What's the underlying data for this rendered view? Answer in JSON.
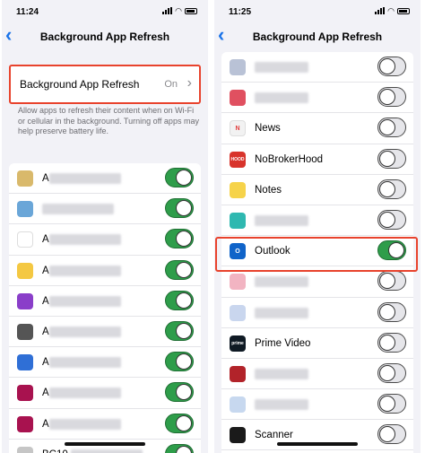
{
  "left": {
    "status_time": "11:24",
    "nav_title": "Background App Refresh",
    "master": {
      "label": "Background App Refresh",
      "value": "On"
    },
    "footnote": "Allow apps to refresh their content when on Wi-Fi or cellular in the background. Turning off apps may help preserve battery life.",
    "apps": [
      {
        "name": "A",
        "icon": "amazon-icon",
        "color": "#d9b96b",
        "on": true
      },
      {
        "name": "",
        "icon": "app-icon",
        "color": "#6aa6d8",
        "on": true
      },
      {
        "name": "A",
        "icon": "arrow-icon",
        "color": "#ffffff",
        "on": true
      },
      {
        "name": "A",
        "icon": "folder-icon",
        "color": "#f4c842",
        "on": true
      },
      {
        "name": "A",
        "icon": "spotify-icon",
        "color": "#8a3ec9",
        "on": true
      },
      {
        "name": "A",
        "icon": "circle-icon",
        "color": "#555555",
        "on": true
      },
      {
        "name": "A",
        "icon": "shield-icon",
        "color": "#2f6fd6",
        "on": true
      },
      {
        "name": "A",
        "icon": "axis-icon",
        "color": "#a8124f",
        "on": true
      },
      {
        "name": "A",
        "icon": "axis-icon",
        "color": "#a8124f",
        "on": true
      },
      {
        "name": "BC10",
        "icon": "app-icon",
        "color": "#c6c6c6",
        "on": true
      }
    ]
  },
  "right": {
    "status_time": "11:25",
    "nav_title": "Background App Refresh",
    "apps": [
      {
        "name": "",
        "icon": "app-icon",
        "color": "#b9c2d6",
        "on": false
      },
      {
        "name": "",
        "icon": "app-icon",
        "color": "#e05060",
        "on": false
      },
      {
        "name": "News",
        "icon": "news-icon",
        "color": "#f2f2f2",
        "on": false,
        "mark": "N"
      },
      {
        "name": "NoBrokerHood",
        "icon": "nobrokerhood-icon",
        "color": "#d8342c",
        "on": false,
        "mark": "HOOD"
      },
      {
        "name": "Notes",
        "icon": "notes-icon",
        "color": "#f6d34a",
        "on": false
      },
      {
        "name": "",
        "icon": "app-icon",
        "color": "#2fb8b0",
        "on": false
      },
      {
        "name": "Outlook",
        "icon": "outlook-icon",
        "color": "#1064c9",
        "on": true,
        "mark": "O"
      },
      {
        "name": "",
        "icon": "app-icon",
        "color": "#f2b4c2",
        "on": false
      },
      {
        "name": "",
        "icon": "app-icon",
        "color": "#c9d6ee",
        "on": false
      },
      {
        "name": "Prime Video",
        "icon": "prime-video-icon",
        "color": "#0f1a24",
        "on": false,
        "mark": "prime"
      },
      {
        "name": "",
        "icon": "app-icon",
        "color": "#b2232a",
        "on": false
      },
      {
        "name": "",
        "icon": "app-icon",
        "color": "#c7d8ef",
        "on": false
      },
      {
        "name": "Scanner",
        "icon": "scanner-icon",
        "color": "#1a1a1a",
        "on": false
      }
    ]
  },
  "colors": {
    "accent": "#1a73e8",
    "toggle_on": "#2e9d4a",
    "highlight": "#e8432d"
  }
}
